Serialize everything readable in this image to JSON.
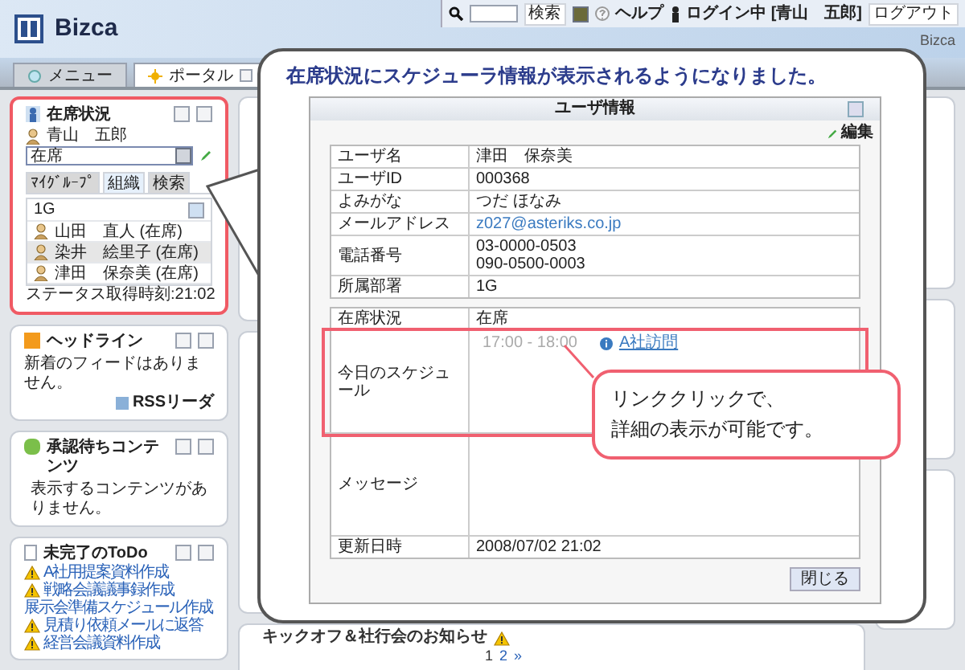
{
  "header": {
    "logo": "Bizca",
    "search_button": "検索",
    "help": "ヘルプ",
    "login": "ログイン中 [青山　五郎]",
    "logout": "ログアウト",
    "site_name": "Bizca"
  },
  "tabs": [
    {
      "label": "メニュー",
      "selected": false
    },
    {
      "label": "ポータル",
      "selected": true
    }
  ],
  "presence": {
    "title": "在席状況",
    "user": "青山　五郎",
    "status": "在席",
    "tabs": [
      {
        "label": "ﾏｲｸﾞﾙｰﾌﾟ",
        "selected": false
      },
      {
        "label": "組織",
        "selected": true
      },
      {
        "label": "検索",
        "selected": false
      }
    ],
    "group": "1G",
    "members": [
      {
        "name": "山田　直人 (在席)",
        "selected": false
      },
      {
        "name": "染井　絵里子 (在席)",
        "selected": true
      },
      {
        "name": "津田　保奈美 (在席)",
        "selected": false
      }
    ],
    "updated": "ステータス取得時刻:21:02"
  },
  "headline": {
    "title": "ヘッドライン",
    "message": "新着のフィードはありません。",
    "link": "RSSリーダ"
  },
  "approval": {
    "title": "承認待ちコンテンツ",
    "message": "表示するコンテンツがありません。"
  },
  "todo": {
    "title": "未完了のToDo",
    "items": [
      {
        "text": "A社用提案資料作成",
        "warning": true
      },
      {
        "text": "戦略会議議事録作成",
        "warning": true
      },
      {
        "text": "展示会準備スケジュール作成",
        "warning": false
      },
      {
        "text": "見積り依頼メールに返答",
        "warning": true
      },
      {
        "text": "経営会議資料作成",
        "warning": true
      }
    ]
  },
  "notice": {
    "title": "キックオフ＆社行会のお知らせ",
    "pages": [
      "1",
      "2"
    ],
    "next": "»"
  },
  "callout": {
    "title": "在席状況にスケジューラ情報が表示されるようになりました。"
  },
  "dialog": {
    "title": "ユーザ情報",
    "edit": "編集",
    "profile": [
      {
        "label": "ユーザ名",
        "values": [
          "津田　保奈美"
        ],
        "kind": "text"
      },
      {
        "label": "ユーザID",
        "values": [
          "000368"
        ],
        "kind": "text"
      },
      {
        "label": "よみがな",
        "values": [
          "つだ ほなみ"
        ],
        "kind": "text"
      },
      {
        "label": "メールアドレス",
        "values": [
          "z027@asteriks.co.jp"
        ],
        "kind": "link"
      },
      {
        "label": "電話番号",
        "values": [
          "03-0000-0503",
          "090-0500-0003"
        ],
        "kind": "text"
      },
      {
        "label": "所属部署",
        "values": [
          "1G"
        ],
        "kind": "text"
      }
    ],
    "status_label": "在席状況",
    "status_value": "在席",
    "schedule_label": "今日のスケジュール",
    "schedule": {
      "time": "17:00 - 18:00",
      "link": "A社訪問"
    },
    "message_label": "メッセージ",
    "updated_label": "更新日時",
    "updated_value": "2008/07/02 21:02",
    "close": "閉じる"
  },
  "note": {
    "lines": [
      "リンククリックで、",
      "詳細の表示が可能です。"
    ]
  }
}
